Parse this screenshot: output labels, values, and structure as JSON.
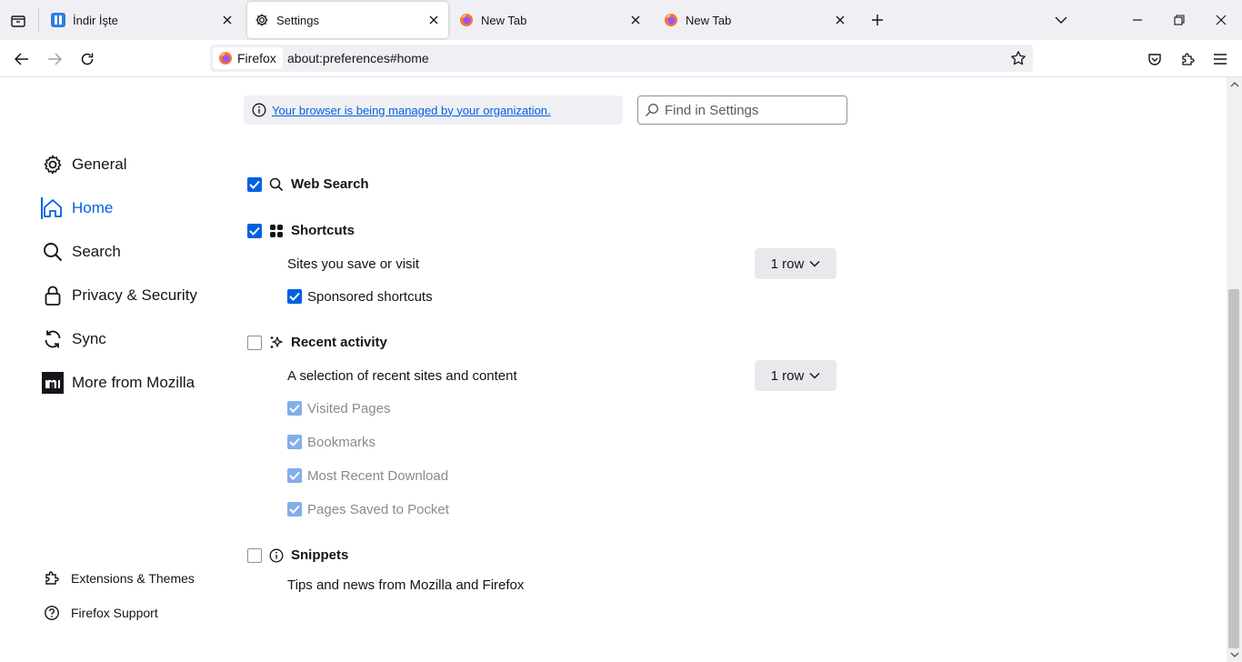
{
  "tabs": [
    {
      "label": "İndir İşte",
      "icon": "indir-favicon",
      "active": false
    },
    {
      "label": "Settings",
      "icon": "gear-icon",
      "active": true
    },
    {
      "label": "New Tab",
      "icon": "firefox-icon",
      "active": false
    },
    {
      "label": "New Tab",
      "icon": "firefox-icon",
      "active": false
    }
  ],
  "navbar": {
    "identity_label": "Firefox",
    "url": "about:preferences#home"
  },
  "policy": {
    "link_text": "Your browser is being managed by your organization."
  },
  "search": {
    "placeholder": "Find in Settings"
  },
  "categories": [
    {
      "label": "General",
      "icon": "gear-icon"
    },
    {
      "label": "Home",
      "icon": "home-icon",
      "selected": true
    },
    {
      "label": "Search",
      "icon": "search-icon"
    },
    {
      "label": "Privacy & Security",
      "icon": "lock-icon"
    },
    {
      "label": "Sync",
      "icon": "sync-icon"
    },
    {
      "label": "More from Mozilla",
      "icon": "mozilla-icon"
    }
  ],
  "footer_links": [
    {
      "label": "Extensions & Themes",
      "icon": "puzzle-icon"
    },
    {
      "label": "Firefox Support",
      "icon": "help-icon"
    }
  ],
  "home_content": {
    "web_search": {
      "label": "Web Search",
      "checked": true
    },
    "shortcuts": {
      "label": "Shortcuts",
      "checked": true,
      "description": "Sites you save or visit",
      "rows_value": "1 row",
      "sponsored": {
        "label": "Sponsored shortcuts",
        "checked": true
      }
    },
    "recent_activity": {
      "label": "Recent activity",
      "checked": false,
      "description": "A selection of recent sites and content",
      "rows_value": "1 row",
      "items": [
        {
          "label": "Visited Pages",
          "checked": true
        },
        {
          "label": "Bookmarks",
          "checked": true
        },
        {
          "label": "Most Recent Download",
          "checked": true
        },
        {
          "label": "Pages Saved to Pocket",
          "checked": true
        }
      ]
    },
    "snippets": {
      "label": "Snippets",
      "checked": false,
      "description": "Tips and news from Mozilla and Firefox"
    }
  },
  "colors": {
    "accent": "#0061e0",
    "tabstrip": "#f0f0f4"
  }
}
